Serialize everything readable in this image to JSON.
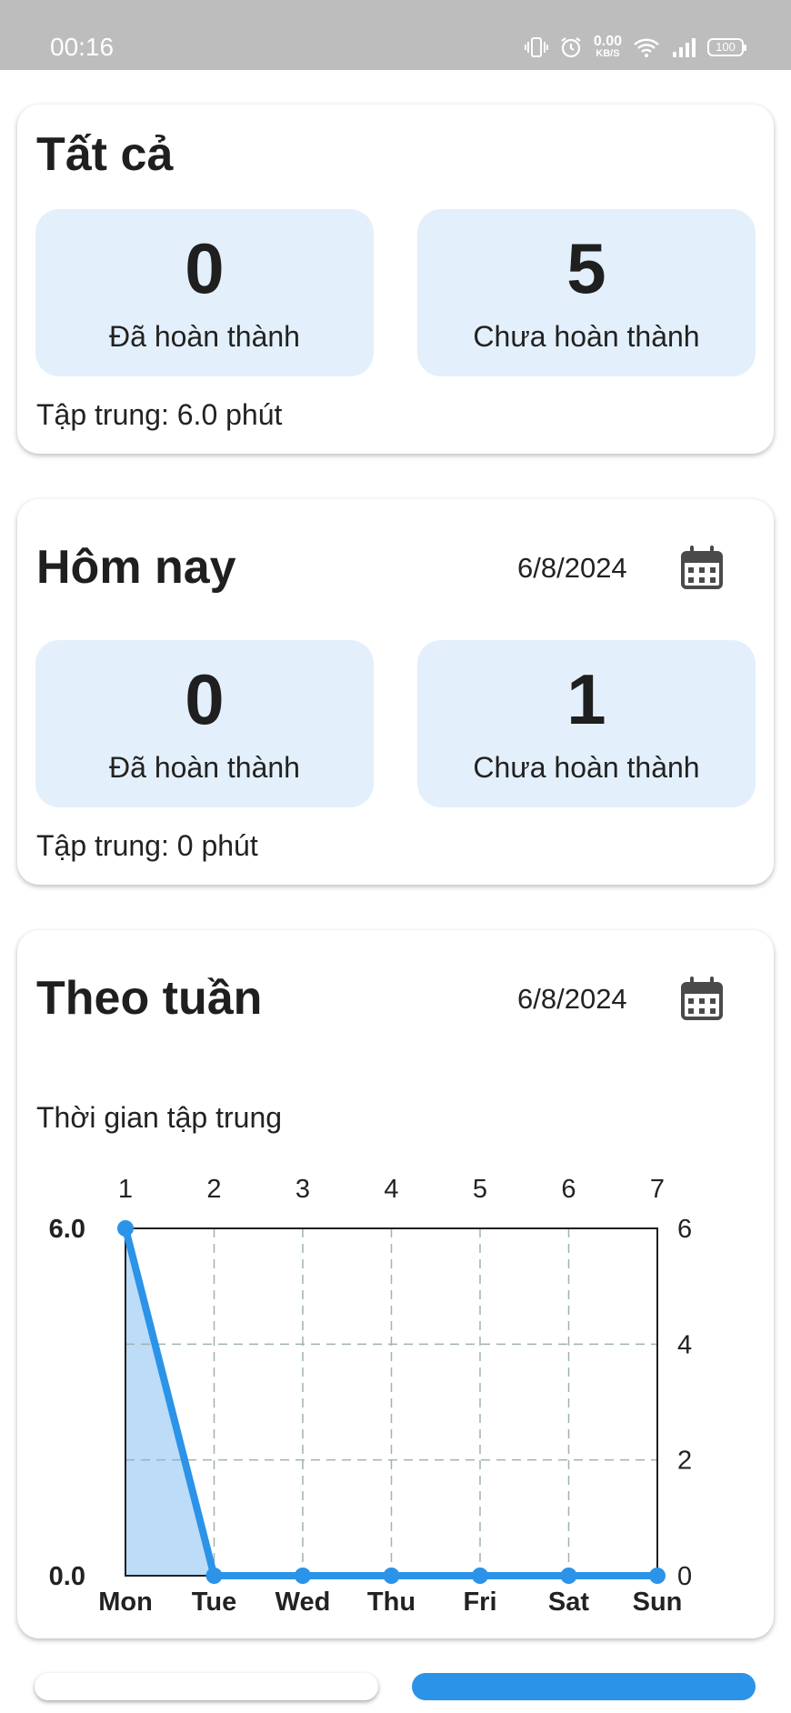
{
  "status_bar": {
    "time": "00:16",
    "net_speed": "0.00",
    "net_unit": "KB/S",
    "battery": "100"
  },
  "all_card": {
    "title": "Tất cả",
    "completed": {
      "value": "0",
      "label": "Đã hoàn thành"
    },
    "pending": {
      "value": "5",
      "label": "Chưa hoàn thành"
    },
    "focus": "Tập trung: 6.0 phút"
  },
  "today_card": {
    "title": "Hôm nay",
    "date": "6/8/2024",
    "completed": {
      "value": "0",
      "label": "Đã hoàn thành"
    },
    "pending": {
      "value": "1",
      "label": "Chưa hoàn thành"
    },
    "focus": "Tập trung: 0 phút"
  },
  "week_card": {
    "title": "Theo tuần",
    "date": "6/8/2024"
  },
  "colors": {
    "accent": "#2b93e8",
    "box_bg": "#e3f0fb",
    "area_fill": "#bcdcf8",
    "grid": "#9fb3ad"
  },
  "chart_data": {
    "type": "line",
    "title": "Thời gian tập trung",
    "categories": [
      "Mon",
      "Tue",
      "Wed",
      "Thu",
      "Fri",
      "Sat",
      "Sun"
    ],
    "top_ticks": [
      "1",
      "2",
      "3",
      "4",
      "5",
      "6",
      "7"
    ],
    "x": [
      1,
      2,
      3,
      4,
      5,
      6,
      7
    ],
    "series": [
      {
        "values": [
          6.0,
          0,
          0,
          0,
          0,
          0,
          0
        ]
      }
    ],
    "ylim": [
      0,
      6
    ],
    "left_ticks": [
      "6.0",
      "0.0"
    ],
    "right_ticks": [
      "6",
      "4",
      "2",
      "0"
    ],
    "grid": true,
    "area_fill": true
  }
}
